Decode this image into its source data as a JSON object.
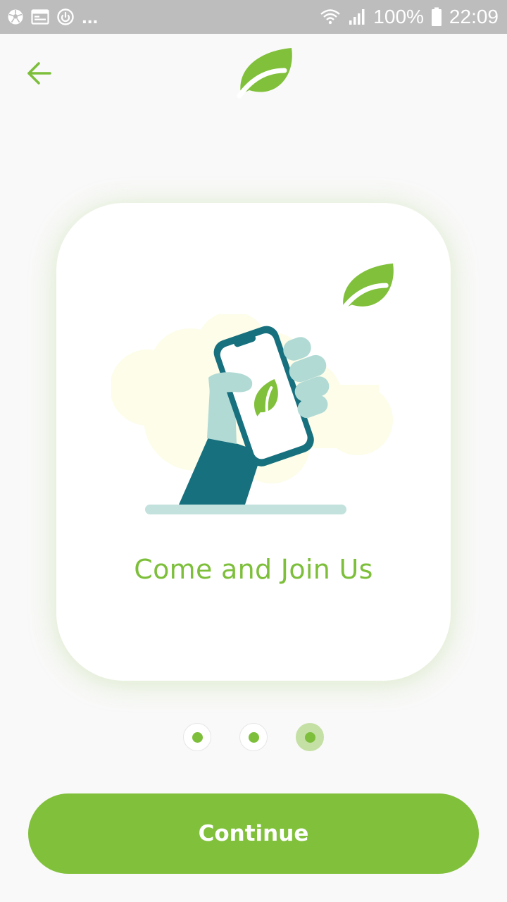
{
  "status_bar": {
    "left_icons": [
      "soccer-ball-icon",
      "calendar-icon",
      "power-circle-icon"
    ],
    "overflow": "...",
    "battery_percent": "100%",
    "time": "22:09"
  },
  "header": {
    "back_icon": "arrow-left-icon",
    "logo_icon": "leaf-logo-icon"
  },
  "slide": {
    "title": "Come and Join Us",
    "illustration": "hand-holding-phone-illustration"
  },
  "pagination": {
    "count": 3,
    "active_index": 2
  },
  "footer": {
    "continue_label": "Continue"
  },
  "colors": {
    "accent": "#80c03a",
    "accent_light": "#c4e0a4",
    "status_bar": "#bdbdbd",
    "teal_dark": "#17707e",
    "teal_light": "#b1dad5",
    "cloud": "#fdfde9"
  }
}
